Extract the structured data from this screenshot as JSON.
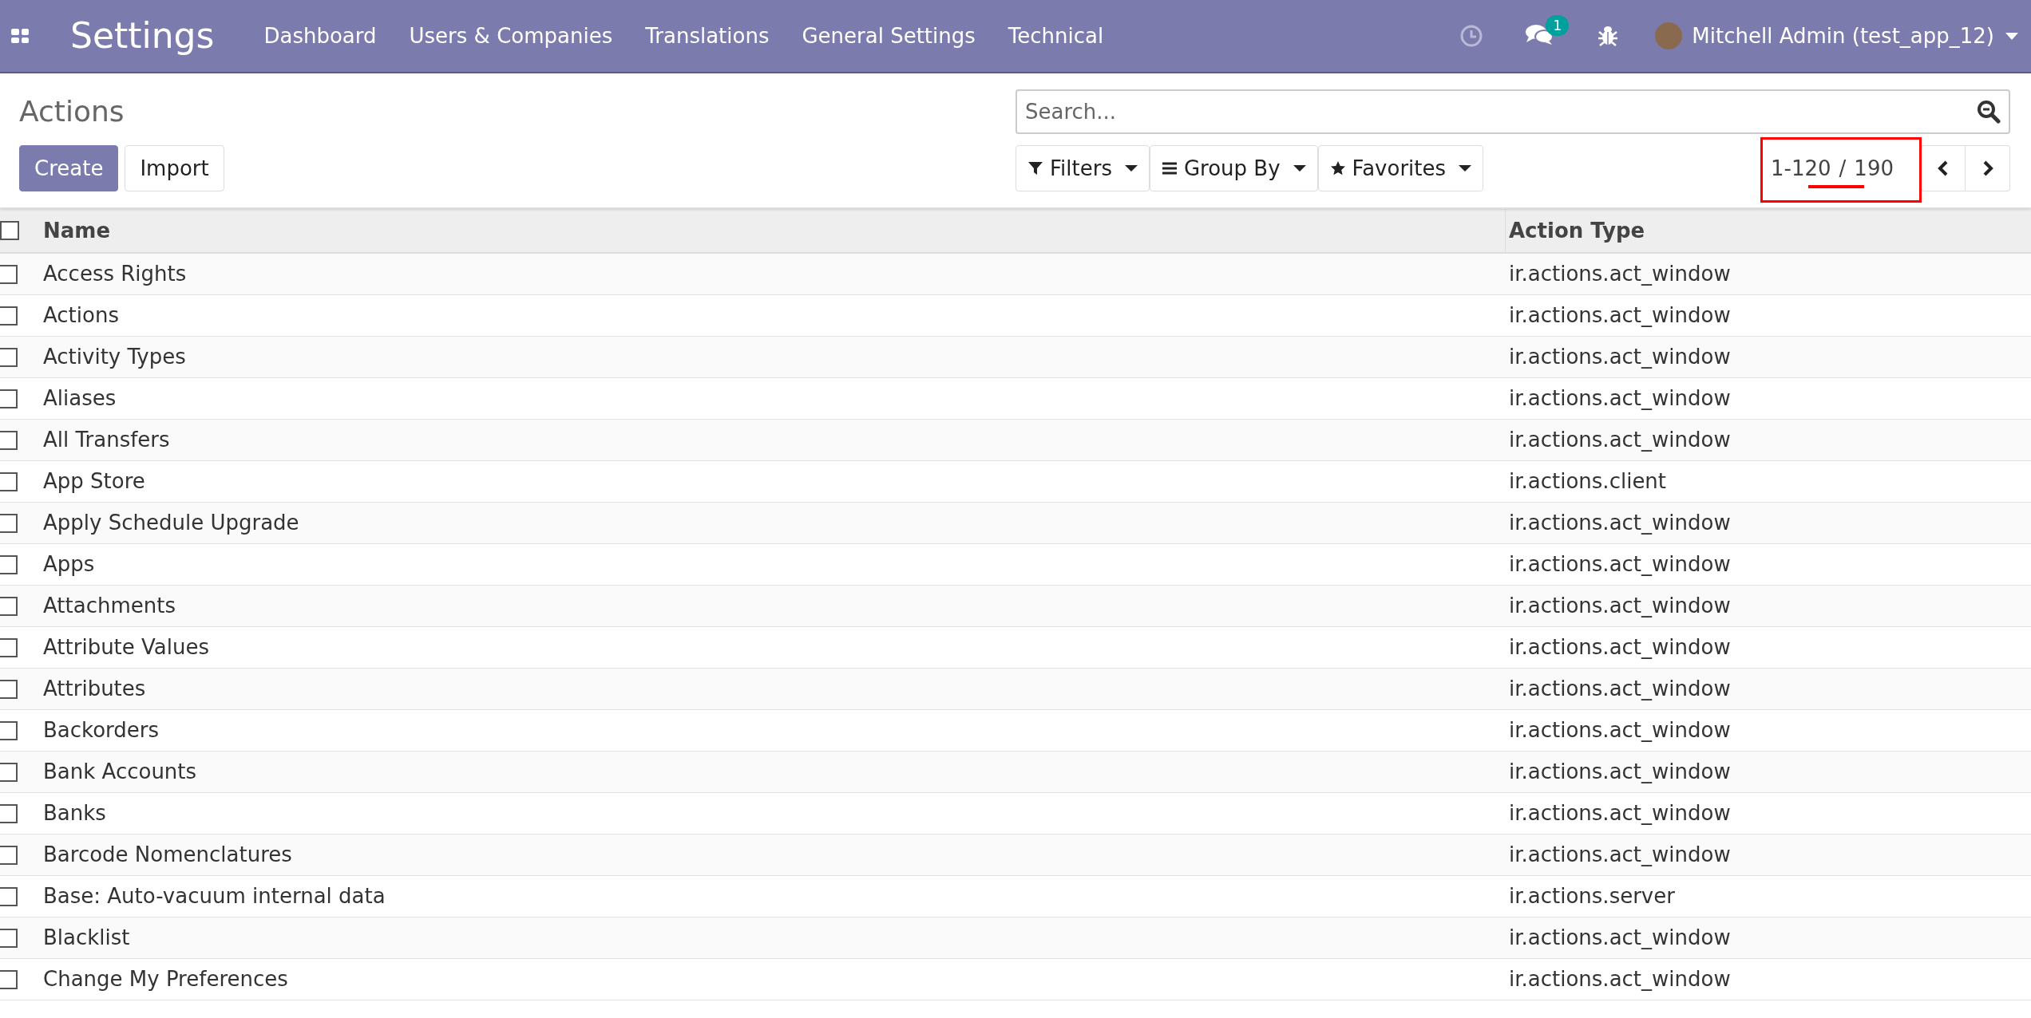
{
  "navbar": {
    "app_title": "Settings",
    "menu": [
      "Dashboard",
      "Users & Companies",
      "Translations",
      "General Settings",
      "Technical"
    ],
    "messages_badge": "1",
    "user": "Mitchell Admin (test_app_12)"
  },
  "control_panel": {
    "breadcrumb": "Actions",
    "buttons": [
      {
        "label": "Create",
        "kind": "primary"
      },
      {
        "label": "Import",
        "kind": "secondary"
      }
    ],
    "search": {
      "placeholder": "Search..."
    },
    "search_options": [
      {
        "label": "Filters",
        "kind": "filter"
      },
      {
        "label": "Group By",
        "kind": "group"
      },
      {
        "label": "Favorites",
        "kind": "star"
      }
    ],
    "pager": {
      "value": "1-120",
      "separator": "/",
      "total": "190",
      "highlighted": true
    }
  },
  "table": {
    "columns": [
      "Name",
      "Action Type"
    ],
    "select_all_checked": false,
    "rows": [
      {
        "name": "Access Rights",
        "type": "ir.actions.act_window",
        "selected": false
      },
      {
        "name": "Actions",
        "type": "ir.actions.act_window",
        "selected": false
      },
      {
        "name": "Activity Types",
        "type": "ir.actions.act_window",
        "selected": false
      },
      {
        "name": "Aliases",
        "type": "ir.actions.act_window",
        "selected": false
      },
      {
        "name": "All Transfers",
        "type": "ir.actions.act_window",
        "selected": false
      },
      {
        "name": "App Store",
        "type": "ir.actions.client",
        "selected": false
      },
      {
        "name": "Apply Schedule Upgrade",
        "type": "ir.actions.act_window",
        "selected": false
      },
      {
        "name": "Apps",
        "type": "ir.actions.act_window",
        "selected": false
      },
      {
        "name": "Attachments",
        "type": "ir.actions.act_window",
        "selected": false
      },
      {
        "name": "Attribute Values",
        "type": "ir.actions.act_window",
        "selected": false
      },
      {
        "name": "Attributes",
        "type": "ir.actions.act_window",
        "selected": false
      },
      {
        "name": "Backorders",
        "type": "ir.actions.act_window",
        "selected": false
      },
      {
        "name": "Bank Accounts",
        "type": "ir.actions.act_window",
        "selected": false
      },
      {
        "name": "Banks",
        "type": "ir.actions.act_window",
        "selected": false
      },
      {
        "name": "Barcode Nomenclatures",
        "type": "ir.actions.act_window",
        "selected": false
      },
      {
        "name": "Base: Auto-vacuum internal data",
        "type": "ir.actions.server",
        "selected": false
      },
      {
        "name": "Blacklist",
        "type": "ir.actions.act_window",
        "selected": false
      },
      {
        "name": "Change My Preferences",
        "type": "ir.actions.act_window",
        "selected": false
      }
    ]
  }
}
